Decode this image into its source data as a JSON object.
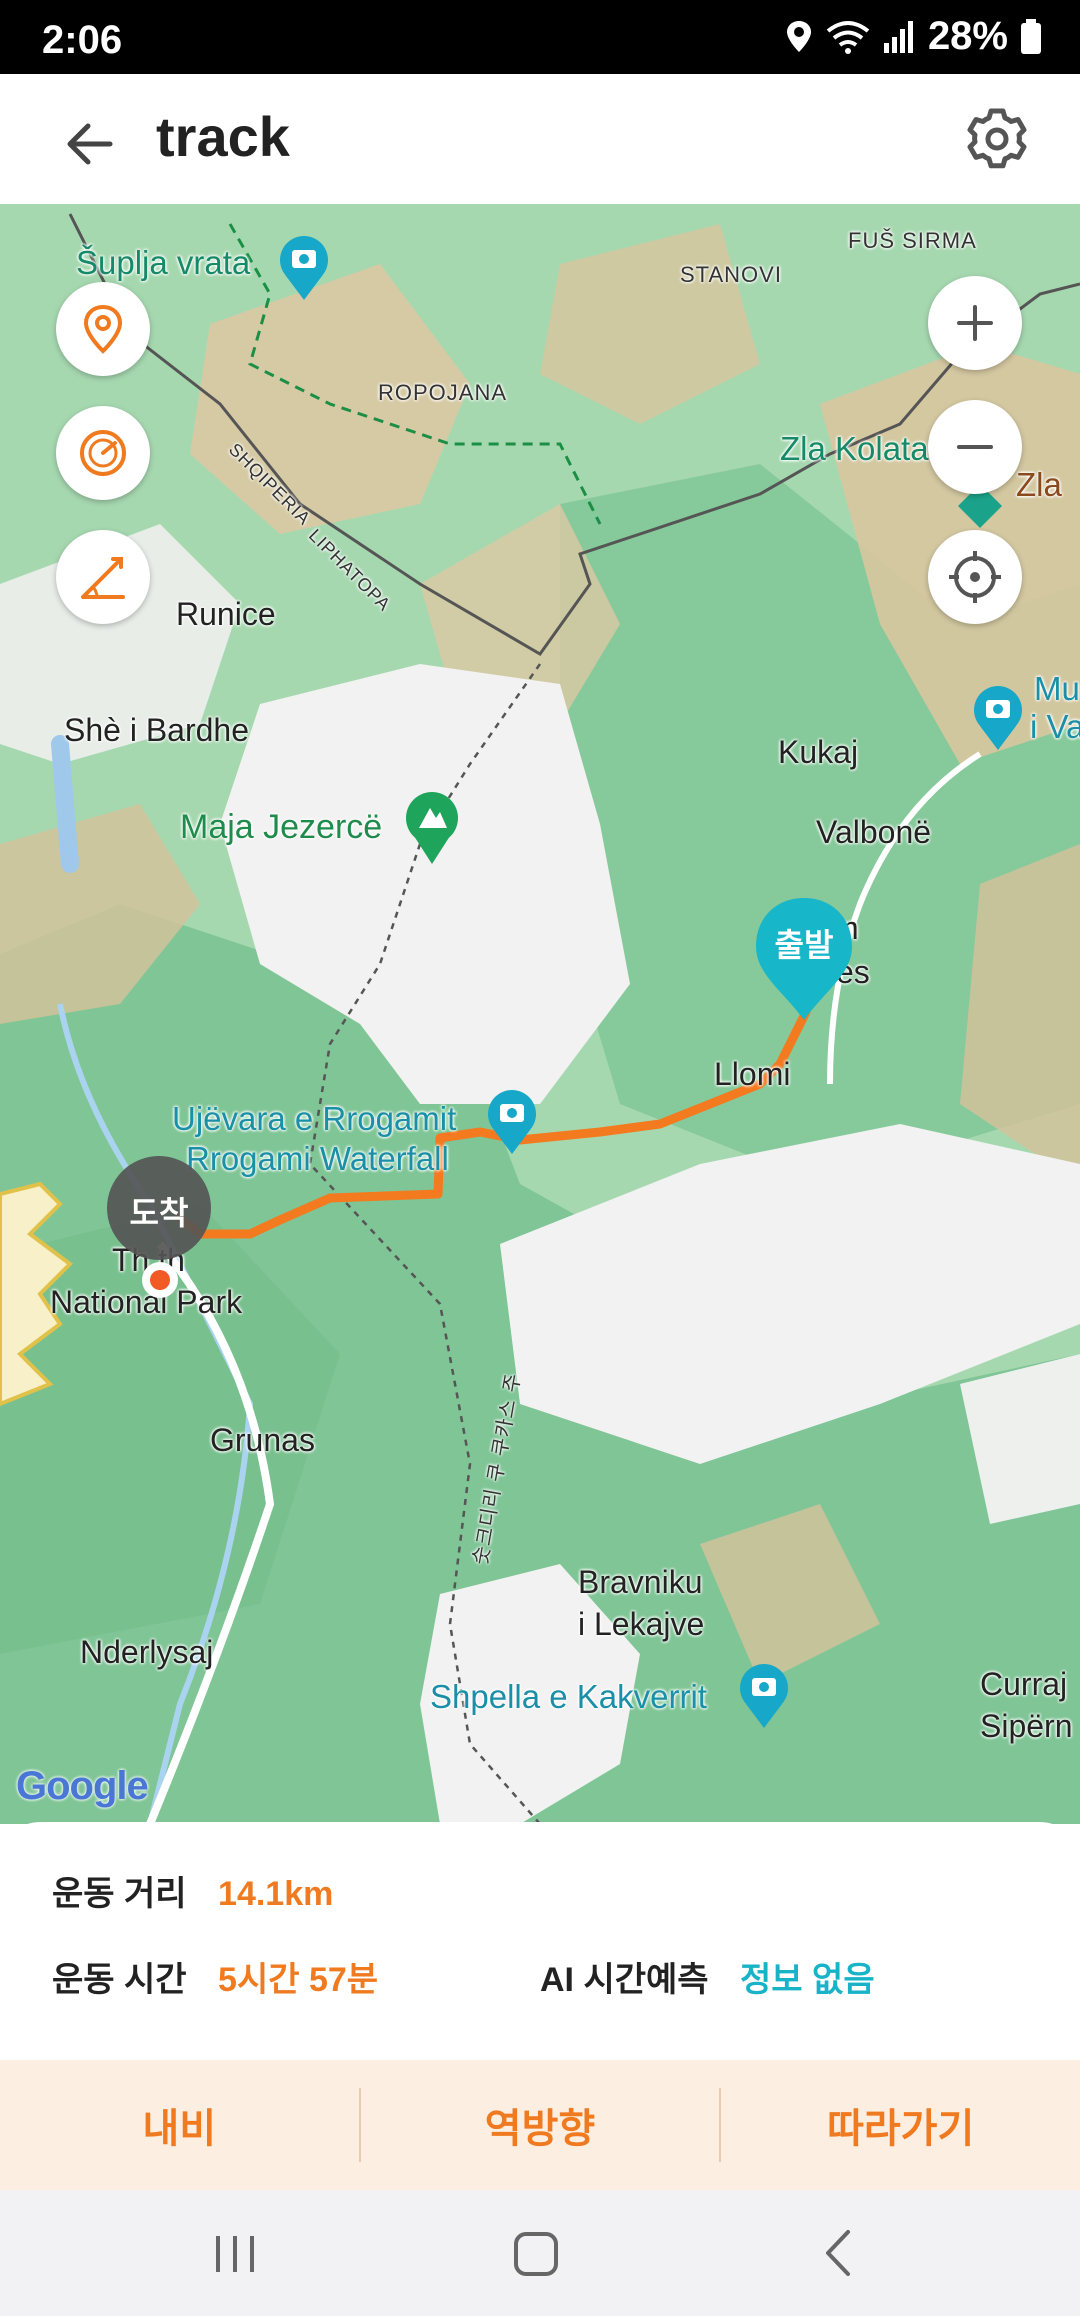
{
  "status_bar": {
    "time": "2:06",
    "battery": "28%"
  },
  "header": {
    "title": "track",
    "back_icon": "arrow-left-icon",
    "settings_icon": "gear-icon"
  },
  "map": {
    "labels": {
      "suplja_vrata": "Šuplja vrata",
      "fus_sirma": "FUŠ SIRMA",
      "stanovi": "STANOVI",
      "ropojana": "ROPOJANA",
      "zla_kolata": "Zla Kolata",
      "zla": "Zla",
      "shqiperia": "SHQIPERIA",
      "liphatopa": "LIPHATOPA",
      "runice": "Runice",
      "she_i_bardhe": "Shè i Bardhe",
      "kukaj": "Kukaj",
      "mu": "Mu",
      "i_va": "i Va",
      "maja_jezerce": "Maja Jezercë",
      "valbone": "Valbonë",
      "rrem_m": "m",
      "rrem_es": "es",
      "llomi": "Llomi",
      "ujevara_1": "Ujëvara e Rrogamit",
      "ujevara_2": "Rrogami Waterfall",
      "theth_1": "Th   th",
      "theth_2": "National Park",
      "grunas": "Grunas",
      "bravniku_1": "Bravniku",
      "bravniku_2": "i Lekajve",
      "nderlysaj": "Nderlysaj",
      "shpella": "Shpella e Kakverrit",
      "curraj_1": "Curraj",
      "curraj_2": "Sipërn",
      "trail_kr": "숫크디리 쿠 쿠카스 주"
    },
    "markers": {
      "start_label": "출발",
      "end_label": "도착"
    },
    "controls": {
      "location_pin_icon": "location-pin-icon",
      "speedometer_icon": "speedometer-icon",
      "elevation_icon": "elevation-icon",
      "zoom_in_icon": "plus-icon",
      "zoom_out_icon": "minus-icon",
      "recenter_icon": "crosshair-icon"
    },
    "attribution": "Google"
  },
  "info": {
    "distance_label": "운동 거리",
    "distance_value": "14.1km",
    "time_label": "운동 시간",
    "time_value": "5시간 57분",
    "ai_label": "AI 시간예측",
    "ai_value": "정보 없음"
  },
  "actions": {
    "navi": "내비",
    "reverse": "역방향",
    "follow": "따라가기"
  },
  "colors": {
    "accent_orange": "#f07a1f",
    "accent_teal": "#19b3c8",
    "route": "#f47a20"
  }
}
